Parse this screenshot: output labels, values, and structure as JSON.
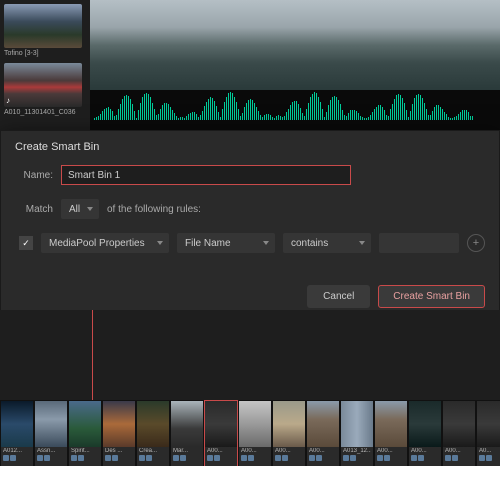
{
  "media": {
    "clip1_label": "Tofino [3-3]",
    "clip2_label": "A010_11301401_C036"
  },
  "dialog": {
    "title": "Create Smart Bin",
    "name_label": "Name:",
    "name_value": "Smart Bin 1",
    "match_label": "Match",
    "match_value": "All",
    "match_suffix": "of the following rules:",
    "rule_property": "MediaPool Properties",
    "rule_field": "File Name",
    "rule_op": "contains",
    "rule_value": "",
    "cancel": "Cancel",
    "confirm": "Create Smart Bin"
  },
  "strip": {
    "clips": [
      {
        "label": "A012...",
        "cls": "c-lake"
      },
      {
        "label": "Assn...",
        "cls": "c-mtn"
      },
      {
        "label": "Spirit...",
        "cls": "c-green"
      },
      {
        "label": "Des ...",
        "cls": "c-sunset"
      },
      {
        "label": "Crea...",
        "cls": "c-forest"
      },
      {
        "label": "Mar...",
        "cls": "c-road"
      },
      {
        "label": "A00...",
        "cls": "c-dark",
        "selected": true
      },
      {
        "label": "A00...",
        "cls": "c-snow"
      },
      {
        "label": "A00...",
        "cls": "c-beach"
      },
      {
        "label": "A00...",
        "cls": "c-person"
      },
      {
        "label": "A013_12...",
        "cls": "c-blur"
      },
      {
        "label": "A00...",
        "cls": "c-person"
      },
      {
        "label": "A00...",
        "cls": "c-dark2"
      },
      {
        "label": "A00...",
        "cls": "c-dark"
      },
      {
        "label": "A0...",
        "cls": "c-dark"
      }
    ]
  }
}
